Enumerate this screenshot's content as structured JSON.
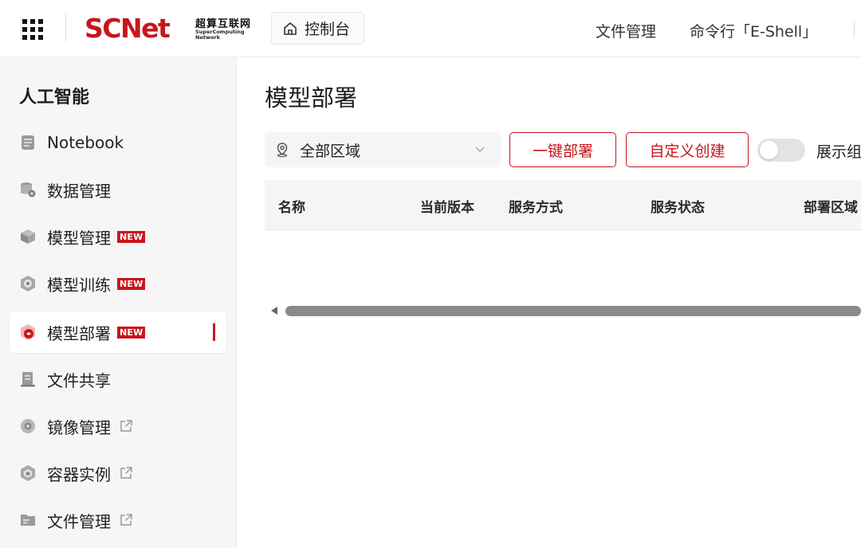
{
  "header": {
    "logo_main": "SCNet",
    "logo_cn": "超算互联网",
    "logo_en_line1": "SuperComputing",
    "logo_en_line2": "Network",
    "console_label": "控制台",
    "nav": [
      "文件管理",
      "命令行「E-Shell」"
    ]
  },
  "sidebar": {
    "title": "人工智能",
    "items": [
      {
        "label": "Notebook",
        "icon": "notebook-icon"
      },
      {
        "label": "数据管理",
        "icon": "database-icon"
      },
      {
        "label": "模型管理",
        "icon": "cube-icon",
        "badge": "NEW"
      },
      {
        "label": "模型训练",
        "icon": "training-icon",
        "badge": "NEW"
      },
      {
        "label": "模型部署",
        "icon": "deploy-icon",
        "badge": "NEW",
        "active": true
      },
      {
        "label": "文件共享",
        "icon": "file-share-icon"
      },
      {
        "label": "镜像管理",
        "icon": "image-icon",
        "external": true
      },
      {
        "label": "容器实例",
        "icon": "container-icon",
        "external": true
      },
      {
        "label": "文件管理",
        "icon": "folder-icon",
        "external": true
      }
    ]
  },
  "main": {
    "title": "模型部署",
    "region_select": {
      "value": "全部区域"
    },
    "buttons": {
      "one_click_deploy": "一键部署",
      "custom_create": "自定义创建"
    },
    "toggle_label": "展示组",
    "table": {
      "columns": [
        "名称",
        "当前版本",
        "服务方式",
        "服务状态",
        "部署区域"
      ],
      "rows": []
    }
  },
  "colors": {
    "brand": "#c8161d",
    "sidebar_bg": "#f6f6f7",
    "table_head_bg": "#f4f5f7"
  }
}
